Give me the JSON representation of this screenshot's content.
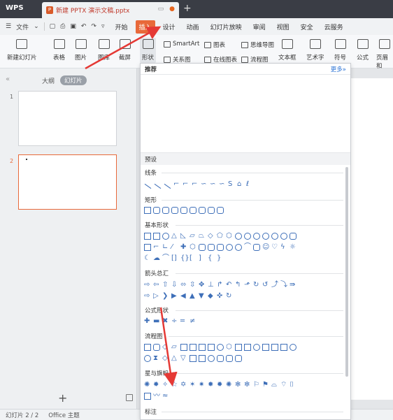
{
  "titlebar": {
    "app_name": "WPS",
    "doc_title": "新建 PPTX 演示文稿.pptx",
    "new_tab": "+"
  },
  "menubar": {
    "file": "文件",
    "items": [
      "开始",
      "插入",
      "设计",
      "动画",
      "幻灯片放映",
      "审阅",
      "视图",
      "安全",
      "云服务"
    ],
    "active": "插入"
  },
  "ribbon": {
    "new_slide": "新建幻灯片",
    "table": "表格",
    "picture": "图片",
    "gallery": "图库",
    "screenshot": "截屏",
    "shape": "形状",
    "smartart": "SmartArt",
    "chart": "图表",
    "mindmap": "思维导图",
    "relation": "关系图",
    "online_chart": "在线图表",
    "flowchart": "流程图",
    "textbox": "文本框",
    "wordart": "艺术字",
    "symbol": "符号",
    "formula": "公式",
    "header_footer": "页眉和"
  },
  "left_panel": {
    "outline_tab": "大纲",
    "slides_tab": "幻灯片",
    "slide_numbers": [
      "1",
      "2"
    ],
    "add": "+"
  },
  "dropdown": {
    "recommend": "推荐",
    "more": "更多»",
    "preset": "预设",
    "sections": [
      "线条",
      "矩形",
      "基本形状",
      "箭头总汇",
      "公式形状",
      "流程图",
      "星与旗帜",
      "标注"
    ]
  },
  "statusbar": {
    "slide_info": "幻灯片 2 / 2",
    "theme": "Office 主题"
  },
  "colors": {
    "accent": "#e8693a",
    "shape_stroke": "#3e6fb8",
    "annotation": "#e53935"
  }
}
